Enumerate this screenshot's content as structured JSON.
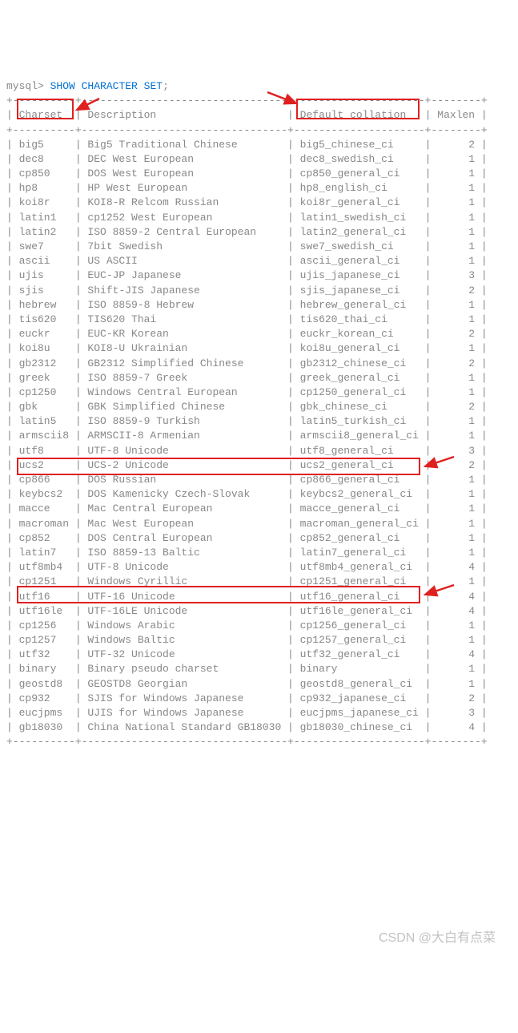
{
  "prompt": "mysql>",
  "command": "SHOW CHARACTER SET",
  "semicolon": ";",
  "header": {
    "charset": "Charset",
    "description": "Description",
    "collation": "Default collation",
    "maxlen": "Maxlen"
  },
  "rows": [
    {
      "charset": "big5",
      "description": "Big5 Traditional Chinese",
      "collation": "big5_chinese_ci",
      "maxlen": "2"
    },
    {
      "charset": "dec8",
      "description": "DEC West European",
      "collation": "dec8_swedish_ci",
      "maxlen": "1"
    },
    {
      "charset": "cp850",
      "description": "DOS West European",
      "collation": "cp850_general_ci",
      "maxlen": "1"
    },
    {
      "charset": "hp8",
      "description": "HP West European",
      "collation": "hp8_english_ci",
      "maxlen": "1"
    },
    {
      "charset": "koi8r",
      "description": "KOI8-R Relcom Russian",
      "collation": "koi8r_general_ci",
      "maxlen": "1"
    },
    {
      "charset": "latin1",
      "description": "cp1252 West European",
      "collation": "latin1_swedish_ci",
      "maxlen": "1"
    },
    {
      "charset": "latin2",
      "description": "ISO 8859-2 Central European",
      "collation": "latin2_general_ci",
      "maxlen": "1"
    },
    {
      "charset": "swe7",
      "description": "7bit Swedish",
      "collation": "swe7_swedish_ci",
      "maxlen": "1"
    },
    {
      "charset": "ascii",
      "description": "US ASCII",
      "collation": "ascii_general_ci",
      "maxlen": "1"
    },
    {
      "charset": "ujis",
      "description": "EUC-JP Japanese",
      "collation": "ujis_japanese_ci",
      "maxlen": "3"
    },
    {
      "charset": "sjis",
      "description": "Shift-JIS Japanese",
      "collation": "sjis_japanese_ci",
      "maxlen": "2"
    },
    {
      "charset": "hebrew",
      "description": "ISO 8859-8 Hebrew",
      "collation": "hebrew_general_ci",
      "maxlen": "1"
    },
    {
      "charset": "tis620",
      "description": "TIS620 Thai",
      "collation": "tis620_thai_ci",
      "maxlen": "1"
    },
    {
      "charset": "euckr",
      "description": "EUC-KR Korean",
      "collation": "euckr_korean_ci",
      "maxlen": "2"
    },
    {
      "charset": "koi8u",
      "description": "KOI8-U Ukrainian",
      "collation": "koi8u_general_ci",
      "maxlen": "1"
    },
    {
      "charset": "gb2312",
      "description": "GB2312 Simplified Chinese",
      "collation": "gb2312_chinese_ci",
      "maxlen": "2"
    },
    {
      "charset": "greek",
      "description": "ISO 8859-7 Greek",
      "collation": "greek_general_ci",
      "maxlen": "1"
    },
    {
      "charset": "cp1250",
      "description": "Windows Central European",
      "collation": "cp1250_general_ci",
      "maxlen": "1"
    },
    {
      "charset": "gbk",
      "description": "GBK Simplified Chinese",
      "collation": "gbk_chinese_ci",
      "maxlen": "2"
    },
    {
      "charset": "latin5",
      "description": "ISO 8859-9 Turkish",
      "collation": "latin5_turkish_ci",
      "maxlen": "1"
    },
    {
      "charset": "armscii8",
      "description": "ARMSCII-8 Armenian",
      "collation": "armscii8_general_ci",
      "maxlen": "1"
    },
    {
      "charset": "utf8",
      "description": "UTF-8 Unicode",
      "collation": "utf8_general_ci",
      "maxlen": "3"
    },
    {
      "charset": "ucs2",
      "description": "UCS-2 Unicode",
      "collation": "ucs2_general_ci",
      "maxlen": "2"
    },
    {
      "charset": "cp866",
      "description": "DOS Russian",
      "collation": "cp866_general_ci",
      "maxlen": "1"
    },
    {
      "charset": "keybcs2",
      "description": "DOS Kamenicky Czech-Slovak",
      "collation": "keybcs2_general_ci",
      "maxlen": "1"
    },
    {
      "charset": "macce",
      "description": "Mac Central European",
      "collation": "macce_general_ci",
      "maxlen": "1"
    },
    {
      "charset": "macroman",
      "description": "Mac West European",
      "collation": "macroman_general_ci",
      "maxlen": "1"
    },
    {
      "charset": "cp852",
      "description": "DOS Central European",
      "collation": "cp852_general_ci",
      "maxlen": "1"
    },
    {
      "charset": "latin7",
      "description": "ISO 8859-13 Baltic",
      "collation": "latin7_general_ci",
      "maxlen": "1"
    },
    {
      "charset": "utf8mb4",
      "description": "UTF-8 Unicode",
      "collation": "utf8mb4_general_ci",
      "maxlen": "4"
    },
    {
      "charset": "cp1251",
      "description": "Windows Cyrillic",
      "collation": "cp1251_general_ci",
      "maxlen": "1"
    },
    {
      "charset": "utf16",
      "description": "UTF-16 Unicode",
      "collation": "utf16_general_ci",
      "maxlen": "4"
    },
    {
      "charset": "utf16le",
      "description": "UTF-16LE Unicode",
      "collation": "utf16le_general_ci",
      "maxlen": "4"
    },
    {
      "charset": "cp1256",
      "description": "Windows Arabic",
      "collation": "cp1256_general_ci",
      "maxlen": "1"
    },
    {
      "charset": "cp1257",
      "description": "Windows Baltic",
      "collation": "cp1257_general_ci",
      "maxlen": "1"
    },
    {
      "charset": "utf32",
      "description": "UTF-32 Unicode",
      "collation": "utf32_general_ci",
      "maxlen": "4"
    },
    {
      "charset": "binary",
      "description": "Binary pseudo charset",
      "collation": "binary",
      "maxlen": "1"
    },
    {
      "charset": "geostd8",
      "description": "GEOSTD8 Georgian",
      "collation": "geostd8_general_ci",
      "maxlen": "1"
    },
    {
      "charset": "cp932",
      "description": "SJIS for Windows Japanese",
      "collation": "cp932_japanese_ci",
      "maxlen": "2"
    },
    {
      "charset": "eucjpms",
      "description": "UJIS for Windows Japanese",
      "collation": "eucjpms_japanese_ci",
      "maxlen": "3"
    },
    {
      "charset": "gb18030",
      "description": "China National Standard GB18030",
      "collation": "gb18030_chinese_ci",
      "maxlen": "4"
    }
  ],
  "watermark": "CSDN @大白有点菜"
}
